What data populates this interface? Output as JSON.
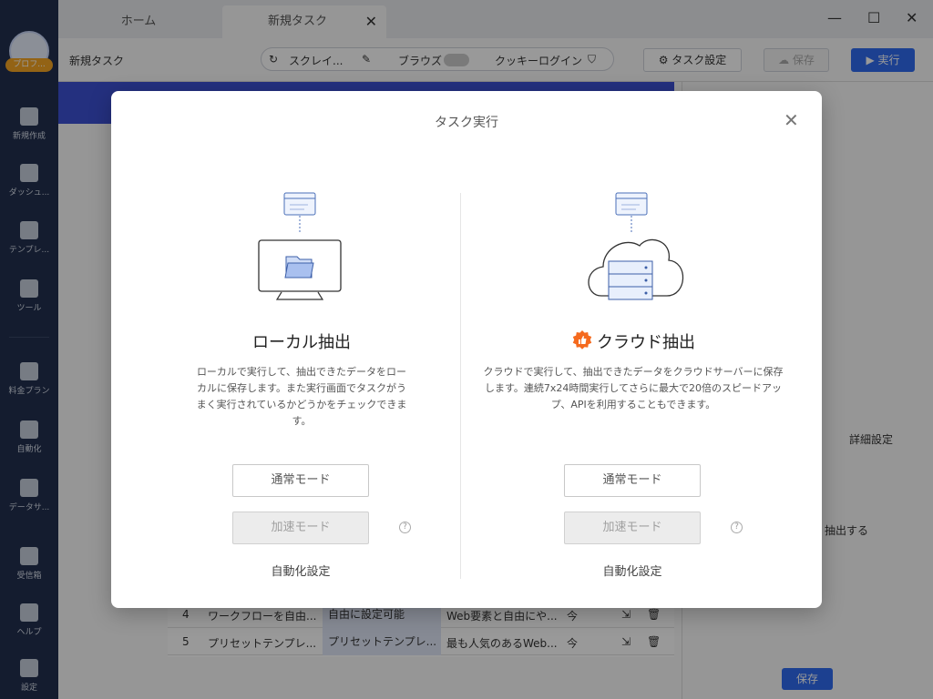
{
  "tabs": {
    "home": "ホーム",
    "active": "新規タスク"
  },
  "sidebar": {
    "profile_badge": "プロフ...",
    "items": [
      "新規作成",
      "ダッシュ...",
      "テンプレ...",
      "ツール",
      "料金プラン",
      "自動化",
      "データサ...",
      "受信箱",
      "ヘルプ",
      "設定"
    ]
  },
  "toolbar": {
    "title": "新規タスク",
    "scrape": "スクレイ...",
    "browse": "ブラウズ",
    "cookie_login": "クッキーログイン",
    "task_settings": "タスク設定",
    "save": "保存",
    "run": "実行"
  },
  "table": {
    "rows": [
      {
        "num": "4",
        "c1": "ワークフローを自由...",
        "c2": "自由に設定可能",
        "c3": "Web要素と自由にや...",
        "c4": "今"
      },
      {
        "num": "5",
        "c1": "プリセットテンプレ...",
        "c2": "プリセットテンプレ...",
        "c3": "最も人気のあるWeb...",
        "c4": "今"
      }
    ]
  },
  "right_panel": {
    "detail_settings": "詳細設定",
    "extract_label": "抽出する",
    "save": "保存"
  },
  "modal": {
    "title": "タスク実行",
    "local": {
      "title": "ローカル抽出",
      "description": "ローカルで実行して、抽出できたデータをローカルに保存します。また実行画面でタスクがうまく実行されているかどうかをチェックできます。",
      "normal_mode": "通常モード",
      "fast_mode": "加速モード",
      "automation": "自動化設定"
    },
    "cloud": {
      "title": "クラウド抽出",
      "description": "クラウドで実行して、抽出できたデータをクラウドサーバーに保存します。連続7x24時間実行してさらに最大で20倍のスピードアップ、APIを利用することもできます。",
      "normal_mode": "通常モード",
      "fast_mode": "加速モード",
      "automation": "自動化設定"
    }
  },
  "colors": {
    "accent": "#2f6bf0",
    "badge": "#f56a1e"
  }
}
